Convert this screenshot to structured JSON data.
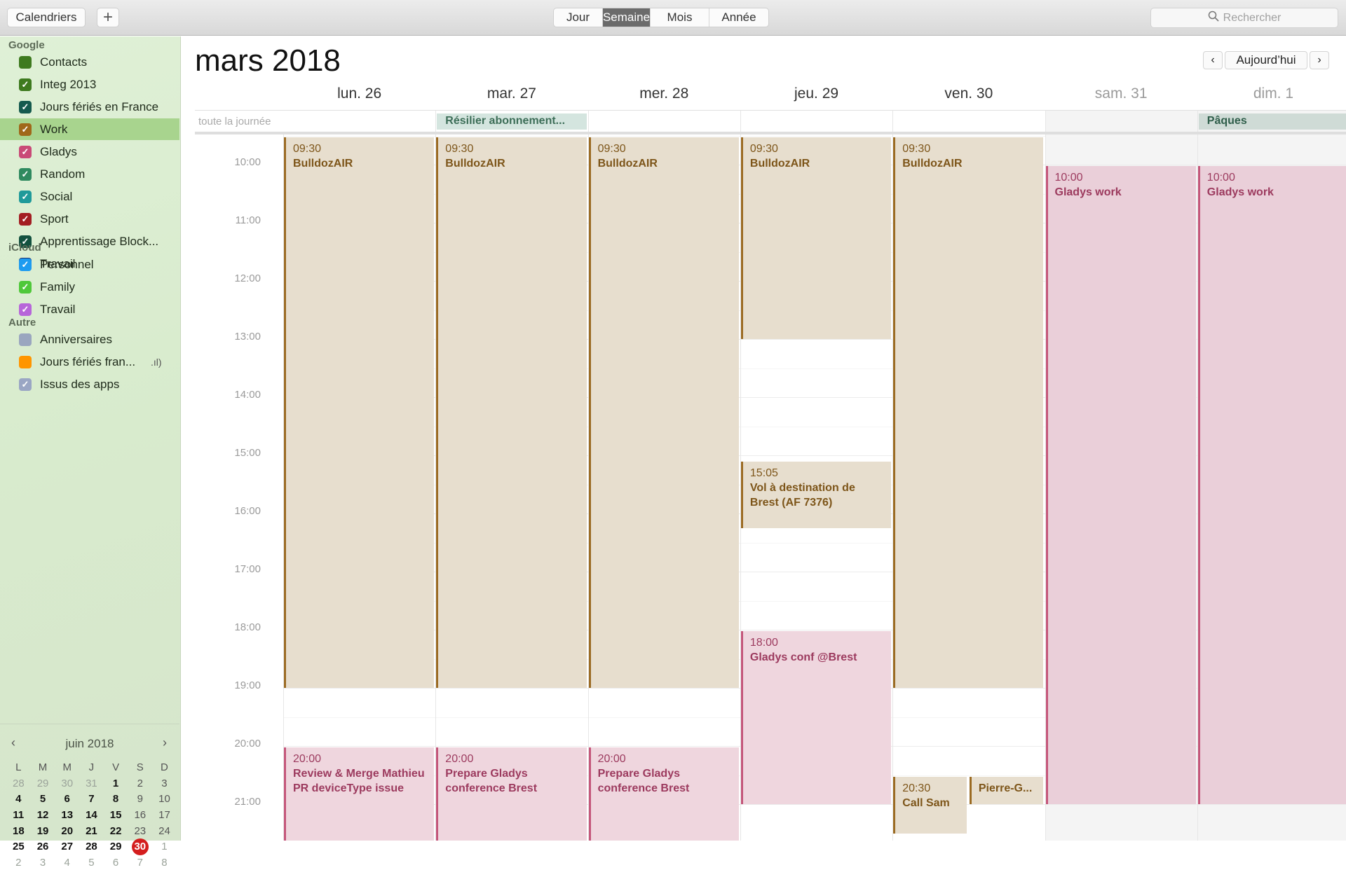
{
  "toolbar": {
    "calendars_label": "Calendriers",
    "add_label": "+",
    "views": [
      {
        "label": "Jour",
        "active": false
      },
      {
        "label": "Semaine",
        "active": true
      },
      {
        "label": "Mois",
        "active": false
      },
      {
        "label": "Année",
        "active": false
      }
    ],
    "search_placeholder": "Rechercher"
  },
  "sidebar": {
    "groups": [
      {
        "label": "Google",
        "items": [
          {
            "name": "Contacts",
            "color": "#3e7a1f",
            "checked": false
          },
          {
            "name": "Integ 2013",
            "color": "#3e7a1f",
            "checked": true
          },
          {
            "name": "Jours fériés en France",
            "color": "#155a4e",
            "checked": true
          },
          {
            "name": "Work",
            "color": "#a0681a",
            "checked": true,
            "selected": true
          },
          {
            "name": "Gladys",
            "color": "#c94a77",
            "checked": true
          },
          {
            "name": "Random",
            "color": "#2f8a5f",
            "checked": true
          },
          {
            "name": "Social",
            "color": "#1f9a9a",
            "checked": true
          },
          {
            "name": "Sport",
            "color": "#a31e22",
            "checked": true
          },
          {
            "name": "Apprentissage Block...",
            "color": "#13513f",
            "checked": true
          },
          {
            "name": "Travail",
            "color": "#1c2f6b",
            "checked": true
          }
        ]
      },
      {
        "label": "iCloud",
        "items": [
          {
            "name": "Personnel",
            "color": "#1e9bf0",
            "checked": true
          },
          {
            "name": "Family",
            "color": "#4fc83a",
            "checked": true
          },
          {
            "name": "Travail",
            "color": "#b766d9",
            "checked": true
          }
        ]
      },
      {
        "label": "Autre",
        "items": [
          {
            "name": "Anniversaires",
            "color": "#9aa6bf",
            "checked": false
          },
          {
            "name": "Jours fériés fran...",
            "color": "#ff9500",
            "checked": false,
            "feed": true
          },
          {
            "name": "Issus des apps",
            "color": "#9aa6c4",
            "checked": true
          }
        ]
      }
    ]
  },
  "mini_calendar": {
    "month_label": "juin 2018",
    "weekday_labels": [
      "L",
      "M",
      "M",
      "J",
      "V",
      "S",
      "D"
    ],
    "weeks": [
      [
        "28",
        "29",
        "30",
        "31",
        "1",
        "2",
        "3"
      ],
      [
        "4",
        "5",
        "6",
        "7",
        "8",
        "9",
        "10"
      ],
      [
        "11",
        "12",
        "13",
        "14",
        "15",
        "16",
        "17"
      ],
      [
        "18",
        "19",
        "20",
        "21",
        "22",
        "23",
        "24"
      ],
      [
        "25",
        "26",
        "27",
        "28",
        "29",
        "30",
        "1"
      ],
      [
        "2",
        "3",
        "4",
        "5",
        "6",
        "7",
        "8"
      ]
    ],
    "today": "30"
  },
  "main": {
    "title": "mars 2018",
    "today_button": "Aujourd’hui",
    "allday_label": "toute la journée",
    "days": [
      {
        "label": "lun. 26",
        "weekend": false
      },
      {
        "label": "mar. 27",
        "weekend": false
      },
      {
        "label": "mer. 28",
        "weekend": false
      },
      {
        "label": "jeu. 29",
        "weekend": false
      },
      {
        "label": "ven. 30",
        "weekend": false
      },
      {
        "label": "sam. 31",
        "weekend": true
      },
      {
        "label": "dim. 1",
        "weekend": true
      }
    ],
    "hours": [
      "10:00",
      "11:00",
      "12:00",
      "13:00",
      "14:00",
      "15:00",
      "16:00",
      "17:00",
      "18:00",
      "19:00",
      "20:00",
      "21:00"
    ],
    "allday_events": [
      {
        "day": 1,
        "title": "Résilier abonnement...",
        "bg": "#d4e5df",
        "color": "#3d6e58"
      },
      {
        "day": 6,
        "title": "Pâques",
        "bg": "#cfdbd6",
        "color": "#2f5e4a"
      }
    ],
    "events": [
      {
        "day": 0,
        "start": 9.5,
        "end": 19,
        "time": "09:30",
        "title": "BulldozAIR",
        "cal": "work"
      },
      {
        "day": 1,
        "start": 9.5,
        "end": 19,
        "time": "09:30",
        "title": "BulldozAIR",
        "cal": "work"
      },
      {
        "day": 2,
        "start": 9.5,
        "end": 19,
        "time": "09:30",
        "title": "BulldozAIR",
        "cal": "work"
      },
      {
        "day": 3,
        "start": 9.5,
        "end": 13,
        "time": "09:30",
        "title": "BulldozAIR",
        "cal": "work"
      },
      {
        "day": 4,
        "start": 9.5,
        "end": 19,
        "time": "09:30",
        "title": "BulldozAIR",
        "cal": "work"
      },
      {
        "day": 3,
        "start": 15.083,
        "end": 16.25,
        "time": "15:05",
        "title": "Vol à destination de Brest (AF 7376)",
        "cal": "work"
      },
      {
        "day": 3,
        "start": 18,
        "end": 21,
        "time": "18:00",
        "title": "Gladys conf @Brest",
        "cal": "gladys"
      },
      {
        "day": 0,
        "start": 20,
        "end": 22,
        "time": "20:00",
        "title": "Review & Merge Mathieu PR deviceType issue",
        "cal": "gladys"
      },
      {
        "day": 1,
        "start": 20,
        "end": 22,
        "time": "20:00",
        "title": "Prepare Gladys conference Brest",
        "cal": "gladys"
      },
      {
        "day": 2,
        "start": 20,
        "end": 22,
        "time": "20:00",
        "title": "Prepare Gladys conference Brest",
        "cal": "gladys"
      },
      {
        "day": 4,
        "start": 20.5,
        "end": 21.5,
        "time": "20:30",
        "title": "Call Sam",
        "cal": "work",
        "half": "left"
      },
      {
        "day": 4,
        "start": 20.5,
        "end": 21,
        "time": "",
        "title": "Pierre-G...",
        "cal": "work",
        "half": "right"
      },
      {
        "day": 5,
        "start": 10,
        "end": 21,
        "time": "10:00",
        "title": "Gladys work",
        "cal": "gladys-we"
      },
      {
        "day": 6,
        "start": 10,
        "end": 21,
        "time": "10:00",
        "title": "Gladys work",
        "cal": "gladys-we"
      }
    ]
  }
}
